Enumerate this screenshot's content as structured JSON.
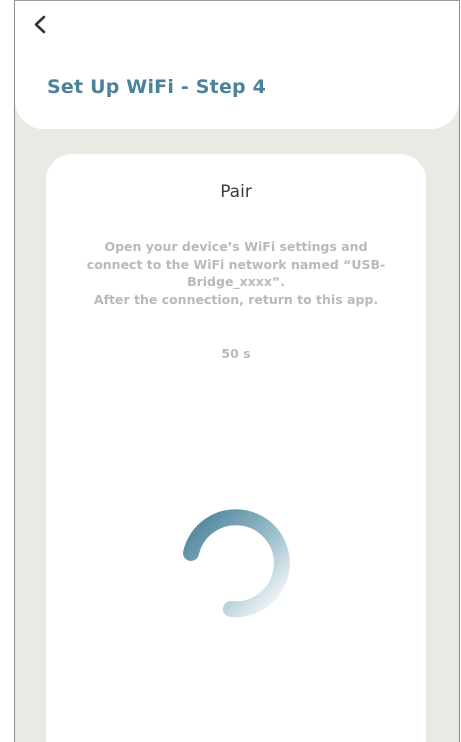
{
  "header": {
    "back_icon": "chevron-left-icon",
    "title": "Set Up WiFi - Step 4"
  },
  "card": {
    "title": "Pair",
    "instructions": [
      "Open your device’s WiFi settings and",
      "connect to the WiFi network named “USB-",
      "Bridge_xxxx”.",
      "After the connection, return to this app."
    ],
    "countdown": "50 s",
    "spinner_icon": "loading-spinner-icon"
  },
  "colors": {
    "accent": "#4a8299",
    "background": "#ebe9e4",
    "muted_text": "#b9b9b9",
    "card": "#ffffff"
  }
}
